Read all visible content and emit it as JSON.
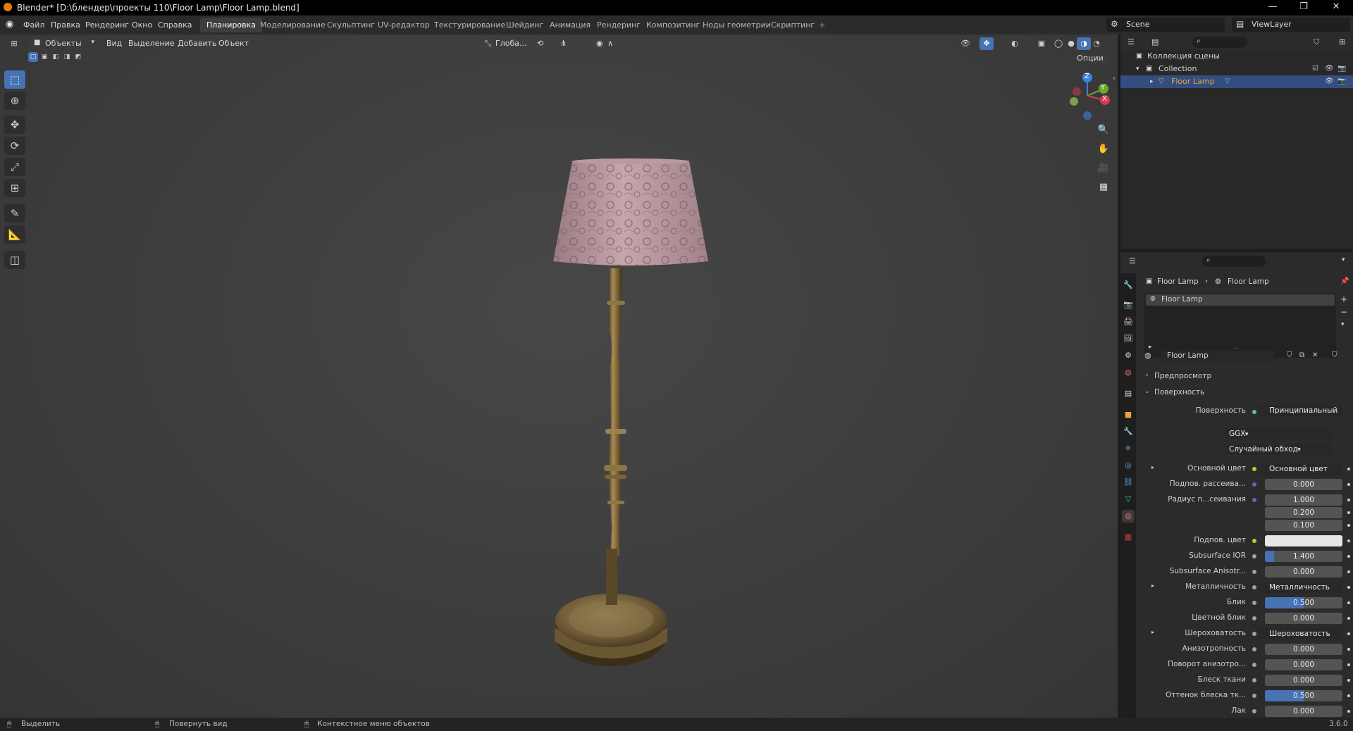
{
  "window": {
    "title": "Blender* [D:\\блендер\\проекты 110\\Floor Lamp\\Floor Lamp.blend]"
  },
  "menu": [
    "Файл",
    "Правка",
    "Рендеринг",
    "Окно",
    "Справка"
  ],
  "workspaces": [
    "Планировка",
    "Моделирование",
    "Скульптинг",
    "UV-редактор",
    "Текстурирование",
    "Шейдинг",
    "Анимация",
    "Рендеринг",
    "Композитинг",
    "Ноды геометрии",
    "Скриптинг"
  ],
  "workspace_add": "+",
  "scene": "Scene",
  "view_layer": "ViewLayer",
  "viewport": {
    "mode": "Объекты",
    "menus": [
      "Вид",
      "Выделение",
      "Добавить",
      "Объект"
    ],
    "orientation": "Глоба...",
    "options": "Опции",
    "gizmo_axes": [
      "Z",
      "Y",
      "X"
    ]
  },
  "outliner": {
    "scene_collection": "Коллекция сцены",
    "collection": "Collection",
    "object": "Floor Lamp"
  },
  "properties": {
    "breadcrumb_object": "Floor Lamp",
    "breadcrumb_material": "Floor Lamp",
    "material_slot": "Floor Lamp",
    "material_name": "Floor Lamp",
    "preview_panel": "Предпросмотр",
    "surface_panel": "Поверхность",
    "surface_label": "Поверхность",
    "surface_value": "Принципиальный BSDF",
    "distribution": "GGX",
    "subsurface_method": "Случайный обход",
    "rows": [
      {
        "label": "Основной цвет",
        "value": "Основной цвет",
        "kind": "link",
        "expand": true,
        "socket": "#c7c729"
      },
      {
        "label": "Подпов. рассеива...",
        "value": "0.000",
        "fill": 0,
        "socket": "#6363c7"
      },
      {
        "label": "Радиус п...сеивания",
        "value": "1.000",
        "fill": 0,
        "socket": "#6363c7"
      },
      {
        "label": "",
        "value": "0.200",
        "fill": 0
      },
      {
        "label": "",
        "value": "0.100",
        "fill": 0
      },
      {
        "label": "Подпов. цвет",
        "value": "",
        "kind": "color",
        "swatch": "#e6e6e6",
        "socket": "#c7c729"
      },
      {
        "label": "Subsurface IOR",
        "value": "1.400",
        "fill": 0.12,
        "socket": "#a1a1a1"
      },
      {
        "label": "Subsurface Anisotr...",
        "value": "0.000",
        "fill": 0,
        "socket": "#a1a1a1"
      },
      {
        "label": "Металличность",
        "value": "Металличность",
        "kind": "link",
        "expand": true,
        "socket": "#a1a1a1"
      },
      {
        "label": "Блик",
        "value": "0.500",
        "fill": 0.5,
        "socket": "#a1a1a1"
      },
      {
        "label": "Цветной блик",
        "value": "0.000",
        "fill": 0,
        "socket": "#a1a1a1"
      },
      {
        "label": "Шероховатость",
        "value": "Шероховатость",
        "kind": "link",
        "expand": true,
        "socket": "#a1a1a1"
      },
      {
        "label": "Анизотропность",
        "value": "0.000",
        "fill": 0,
        "socket": "#a1a1a1"
      },
      {
        "label": "Поворот анизотро...",
        "value": "0.000",
        "fill": 0,
        "socket": "#a1a1a1"
      },
      {
        "label": "Блеск ткани",
        "value": "0.000",
        "fill": 0,
        "socket": "#a1a1a1"
      },
      {
        "label": "Оттенок блеска тк...",
        "value": "0.500",
        "fill": 0.5,
        "socket": "#a1a1a1"
      },
      {
        "label": "Лак",
        "value": "0.000",
        "fill": 0,
        "socket": "#a1a1a1"
      }
    ]
  },
  "statusbar": {
    "select": "Выделить",
    "rotate": "Повернуть вид",
    "context": "Контекстное меню объектов",
    "version": "3.6.0"
  },
  "colors": {
    "accent": "#4772b3",
    "active_object": "#f0a040",
    "header": "#2b2b2b"
  }
}
